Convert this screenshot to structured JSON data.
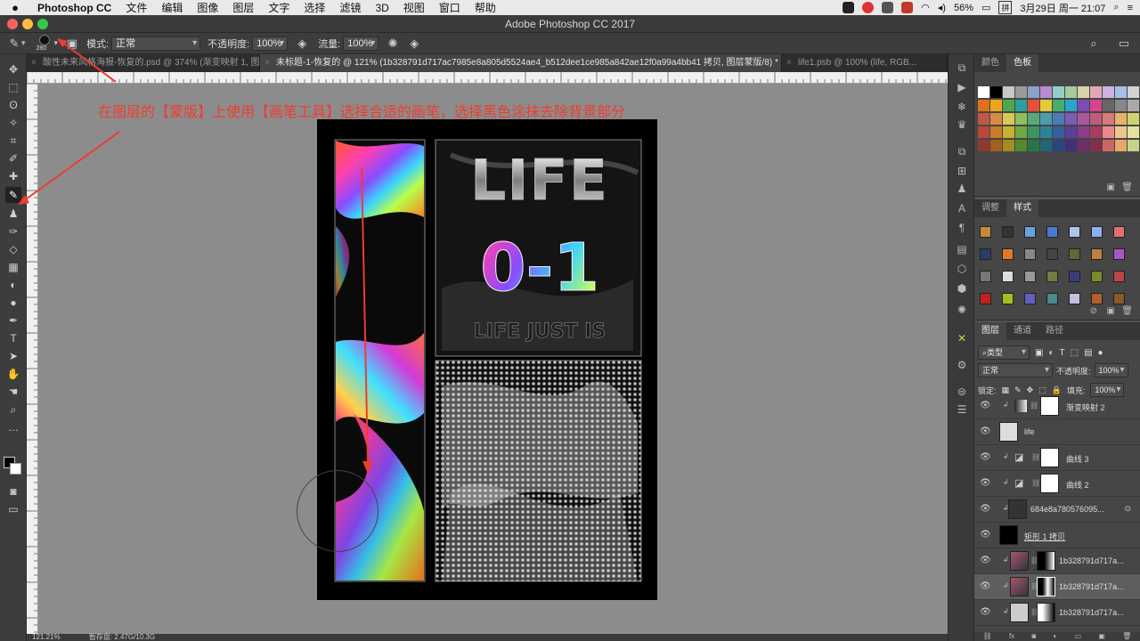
{
  "menubar": {
    "apple": "",
    "app": "Photoshop CC",
    "items": [
      "文件",
      "编辑",
      "图像",
      "图层",
      "文字",
      "选择",
      "滤镜",
      "3D",
      "视图",
      "窗口",
      "帮助"
    ],
    "battery": "56%",
    "date": "3月29日 周一 21:07"
  },
  "window": {
    "title": "Adobe Photoshop CC 2017"
  },
  "options": {
    "brush_size": "280",
    "mode_label": "模式:",
    "mode_value": "正常",
    "opacity_label": "不透明度:",
    "opacity_value": "100%",
    "flow_label": "流量:",
    "flow_value": "100%"
  },
  "tabs": [
    "酸性未来风格海报-恢复的.psd @ 374% (渐变映射 1, 图...",
    "未标题-1-恢复的 @ 121% (1b328791d717ac7985e8a805d5524ae4_b512dee1ce985a842ae12f0a99a4bb41 拷贝, 图层蒙版/8) *",
    "life1.psb @ 100% (life, RGB..."
  ],
  "annotation": "在图层的【蒙版】上使用【画笔工具】选择合适的画笔，选择黑色涂抹去除背景部分",
  "poster": {
    "title1": "LIFE",
    "title2": "0-1",
    "subtitle": "LIFE JUST IS"
  },
  "status": {
    "zoom": "121.21%",
    "doc": "暂存盘: 2.47G/10.3G"
  },
  "panels": {
    "color_tabs": [
      "颜色",
      "色板"
    ],
    "style_tabs": [
      "调整",
      "样式"
    ],
    "layer_tabs": [
      "图层",
      "通道",
      "路径"
    ],
    "filter_label": "类型",
    "blend_mode": "正常",
    "opacity_label": "不透明度:",
    "opacity_value": "100%",
    "lock_label": "锁定:",
    "fill_label": "填充:",
    "fill_value": "100%"
  },
  "layers": [
    {
      "name": "渐变映射 2",
      "selected": false
    },
    {
      "name": "life",
      "selected": false
    },
    {
      "name": "曲线 3",
      "selected": false
    },
    {
      "name": "曲线 2",
      "selected": false
    },
    {
      "name": "684e8a780576095...",
      "selected": false
    },
    {
      "name": "矩形 1 拷贝",
      "selected": false
    },
    {
      "name": "1b328791d717a...",
      "selected": false
    },
    {
      "name": "1b328791d717a...",
      "selected": true
    },
    {
      "name": "1b328791d717a...",
      "selected": false
    }
  ],
  "colors": {
    "accent_red": "#f03c2f",
    "canvas_gray": "#8c8c8c"
  }
}
